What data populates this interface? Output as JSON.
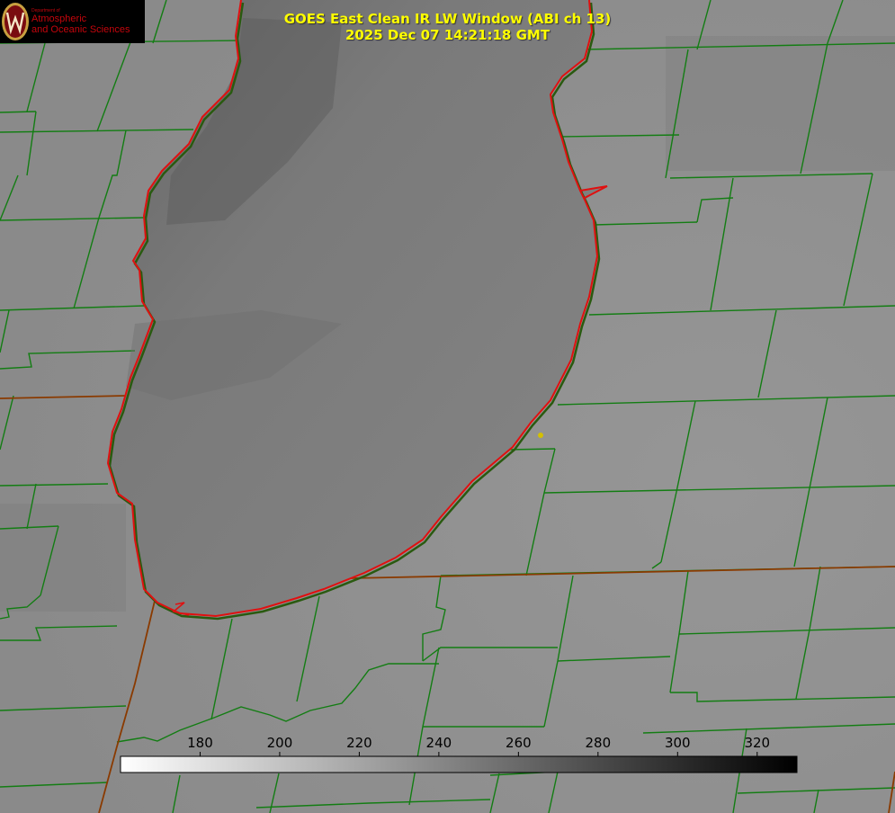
{
  "logo": {
    "department": "Department of",
    "line1": "Atmospheric",
    "line2": "and Oceanic Sciences",
    "emblem": "W"
  },
  "title": {
    "line1": "GOES East Clean IR LW Window (ABI ch 13)",
    "line2": "2025 Dec 07 14:21:18 GMT"
  },
  "colorbar": {
    "min": 160,
    "max": 330,
    "ticks": [
      180,
      200,
      220,
      240,
      260,
      280,
      300,
      320
    ],
    "gradient": [
      "#ffffff",
      "#000000"
    ]
  },
  "colors": {
    "background": "#8e8e8e",
    "lake": "#7a7a7a",
    "county_lines": "#137d13",
    "state_lines": "#8a3a00",
    "lake_outline": "#e01010",
    "title": "#ffff00",
    "marker": "#d4c000"
  },
  "icons": {
    "logo_emblem": "uw-crest-icon",
    "location_marker": "dot-marker-icon"
  }
}
